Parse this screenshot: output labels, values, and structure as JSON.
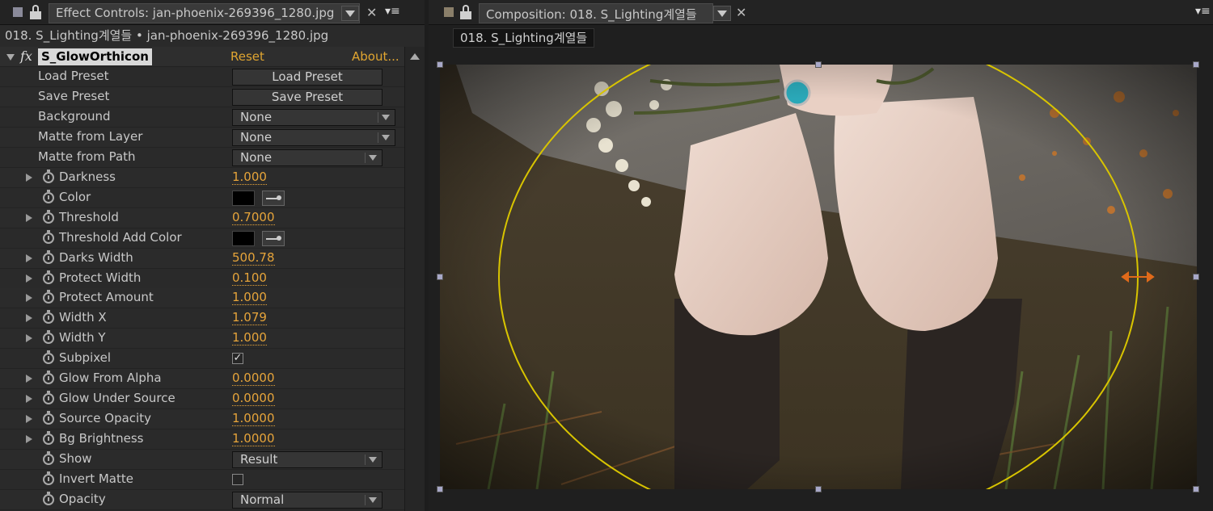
{
  "left_panel": {
    "tab_title": "Effect Controls: jan-phoenix-269396_1280.jpg",
    "breadcrumb": "018. S_Lighting계열들 • jan-phoenix-269396_1280.jpg",
    "fx_icon": "fx",
    "effect_name": "S_GlowOrthicon",
    "reset_label": "Reset",
    "about_label": "About...",
    "rows": [
      {
        "label": "Load Preset",
        "kind": "button",
        "value": "Load Preset"
      },
      {
        "label": "Save Preset",
        "kind": "button",
        "value": "Save Preset"
      },
      {
        "label": "Background",
        "kind": "select",
        "value": "None"
      },
      {
        "label": "Matte from Layer",
        "kind": "select",
        "value": "None"
      },
      {
        "label": "Matte from Path",
        "kind": "select",
        "value": "None"
      },
      {
        "label": "Darkness",
        "kind": "number",
        "value": "1.000"
      },
      {
        "label": "Color",
        "kind": "color",
        "value": "#000000"
      },
      {
        "label": "Threshold",
        "kind": "number",
        "value": "0.7000"
      },
      {
        "label": "Threshold Add Color",
        "kind": "color",
        "value": "#000000"
      },
      {
        "label": "Darks Width",
        "kind": "number",
        "value": "500.78"
      },
      {
        "label": "Protect Width",
        "kind": "number",
        "value": "0.100"
      },
      {
        "label": "Protect Amount",
        "kind": "number",
        "value": "1.000"
      },
      {
        "label": "Width X",
        "kind": "number",
        "value": "1.079"
      },
      {
        "label": "Width Y",
        "kind": "number",
        "value": "1.000"
      },
      {
        "label": "Subpixel",
        "kind": "checkbox",
        "checked": true
      },
      {
        "label": "Glow From Alpha",
        "kind": "number",
        "value": "0.0000"
      },
      {
        "label": "Glow Under Source",
        "kind": "number",
        "value": "0.0000"
      },
      {
        "label": "Source Opacity",
        "kind": "number",
        "value": "1.0000"
      },
      {
        "label": "Bg Brightness",
        "kind": "number",
        "value": "1.0000"
      },
      {
        "label": "Show",
        "kind": "select",
        "value": "Result"
      },
      {
        "label": "Invert Matte",
        "kind": "checkbox",
        "checked": false
      },
      {
        "label": "Opacity",
        "kind": "select",
        "value": "Normal"
      }
    ]
  },
  "right_panel": {
    "tab_title": "Composition: 018. S_Lighting계열들",
    "comp_tab": "018. S_Lighting계열들"
  },
  "colors": {
    "accent_orange": "#e6a43a",
    "guide_circle": "#d8c400",
    "handle_arrow": "#e06a1a"
  },
  "icons": [
    "lock-icon",
    "chevron-down-icon",
    "close-icon",
    "panel-menu-icon",
    "stopwatch-icon",
    "twirl-arrow-icon",
    "eyedropper-icon",
    "checkmark-icon"
  ]
}
